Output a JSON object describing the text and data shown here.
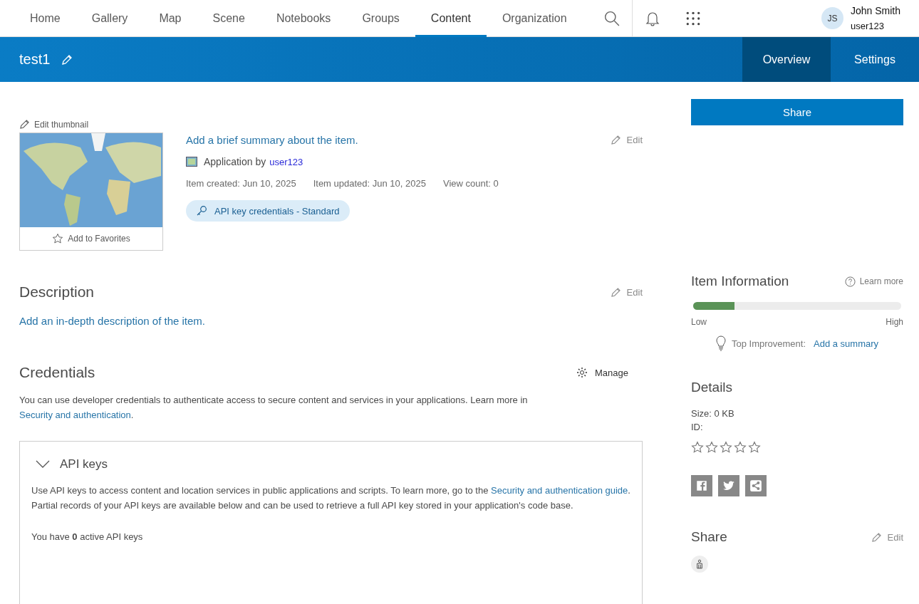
{
  "nav": {
    "items": [
      {
        "label": "Home",
        "selected": false
      },
      {
        "label": "Gallery",
        "selected": false
      },
      {
        "label": "Map",
        "selected": false
      },
      {
        "label": "Scene",
        "selected": false
      },
      {
        "label": "Notebooks",
        "selected": false
      },
      {
        "label": "Groups",
        "selected": false
      },
      {
        "label": "Content",
        "selected": true
      },
      {
        "label": "Organization",
        "selected": false
      }
    ],
    "user": {
      "initials": "JS",
      "name": "John Smith",
      "username": "user123"
    }
  },
  "header": {
    "title": "test1",
    "tabs": [
      {
        "label": "Overview",
        "selected": true
      },
      {
        "label": "Settings",
        "selected": false
      }
    ]
  },
  "item": {
    "edit_thumbnail": "Edit thumbnail",
    "add_to_favorites": "Add to Favorites",
    "summary": "Add a brief summary about the item.",
    "edit": "Edit",
    "type_prefix": "Application by",
    "owner": "user123",
    "created": "Item created: Jun 10, 2025",
    "updated": "Item updated: Jun 10, 2025",
    "views": "View count: 0",
    "tag": "API key credentials - Standard"
  },
  "description": {
    "title": "Description",
    "edit": "Edit",
    "placeholder": "Add an in-depth description of the item."
  },
  "credentials": {
    "title": "Credentials",
    "manage": "Manage",
    "text": {
      "before": "You can use developer credentials to authenticate access to secure content and services in your applications. Learn more in ",
      "link": "Security and authentication",
      "after": "."
    },
    "api_keys": {
      "title": "API keys",
      "expanded": true,
      "text": {
        "before": "Use API keys to access content and location services in public applications and scripts. To learn more, go to the ",
        "link": "Security and authentication guide",
        "after": ". Partial records of your API keys are available below and can be used to retrieve a full API key stored in your application's code base."
      },
      "count_text": "You have **0** active API keys"
    }
  },
  "sidebar": {
    "share_button": "Share",
    "item_information": {
      "title": "Item Information",
      "learn_more": "Learn more",
      "level": 0.2,
      "low": "Low",
      "high": "High",
      "improvement_label": "Top Improvement:",
      "improvement_link": "Add a summary"
    },
    "details": {
      "title": "Details",
      "size": "Size: 0 KB",
      "id": "ID:",
      "stars": 0
    },
    "share": {
      "title": "Share",
      "edit": "Edit"
    }
  }
}
